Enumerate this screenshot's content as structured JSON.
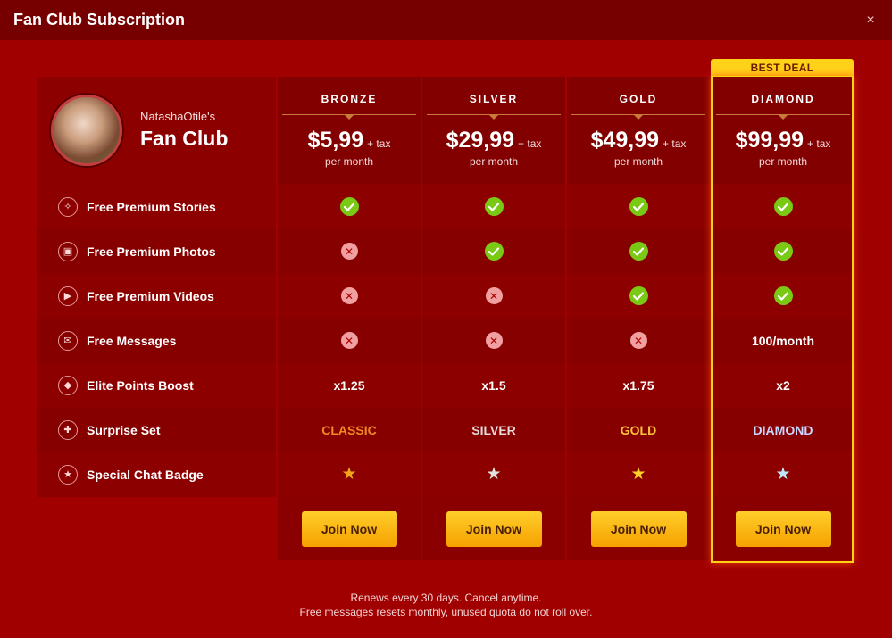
{
  "modal": {
    "title": "Fan Club Subscription",
    "close_symbol": "×"
  },
  "club": {
    "owner": "NatashaOtile's",
    "name": "Fan Club"
  },
  "best_deal_label": "BEST DEAL",
  "tiers": [
    {
      "name": "BRONZE",
      "price": "$5,99",
      "tax": "+ tax",
      "period": "per month",
      "join_label": "Join Now",
      "accent": "#f08a24"
    },
    {
      "name": "SILVER",
      "price": "$29,99",
      "tax": "+ tax",
      "period": "per month",
      "join_label": "Join Now",
      "accent": "#e9dada"
    },
    {
      "name": "GOLD",
      "price": "$49,99",
      "tax": "+ tax",
      "period": "per month",
      "join_label": "Join Now",
      "accent": "#ffc23a"
    },
    {
      "name": "DIAMOND",
      "price": "$99,99",
      "tax": "+ tax",
      "period": "per month",
      "join_label": "Join Now",
      "accent": "#c9d6ff"
    }
  ],
  "features": [
    {
      "label": "Free Premium Stories",
      "icon": "stories-icon",
      "values": [
        "check",
        "check",
        "check",
        "check"
      ]
    },
    {
      "label": "Free Premium Photos",
      "icon": "photos-icon",
      "values": [
        "cross",
        "check",
        "check",
        "check"
      ]
    },
    {
      "label": "Free Premium Videos",
      "icon": "videos-icon",
      "values": [
        "cross",
        "cross",
        "check",
        "check"
      ]
    },
    {
      "label": "Free Messages",
      "icon": "messages-icon",
      "values": [
        "cross",
        "cross",
        "cross",
        "100/month"
      ]
    },
    {
      "label": "Elite Points Boost",
      "icon": "diamond-icon",
      "values": [
        "x1.25",
        "x1.5",
        "x1.75",
        "x2"
      ]
    },
    {
      "label": "Surprise Set",
      "icon": "gift-icon",
      "values": [
        "CLASSIC",
        "SILVER",
        "GOLD",
        "DIAMOND"
      ]
    },
    {
      "label": "Special Chat Badge",
      "icon": "star-icon",
      "values": [
        "star",
        "star",
        "star",
        "star"
      ]
    }
  ],
  "star_colors": [
    "#f4a21c",
    "#e2e2e2",
    "#ffcf2a",
    "#bfe6ff"
  ],
  "footer": {
    "line1": "Renews every 30 days. Cancel anytime.",
    "line2": "Free messages resets monthly, unused quota do not roll over."
  },
  "colors": {
    "background": "#a00000",
    "header": "#760000",
    "check": "#79c915",
    "cross": "#f0a0a0",
    "button": "#ffc21a",
    "best_deal": "#ffd21a"
  }
}
